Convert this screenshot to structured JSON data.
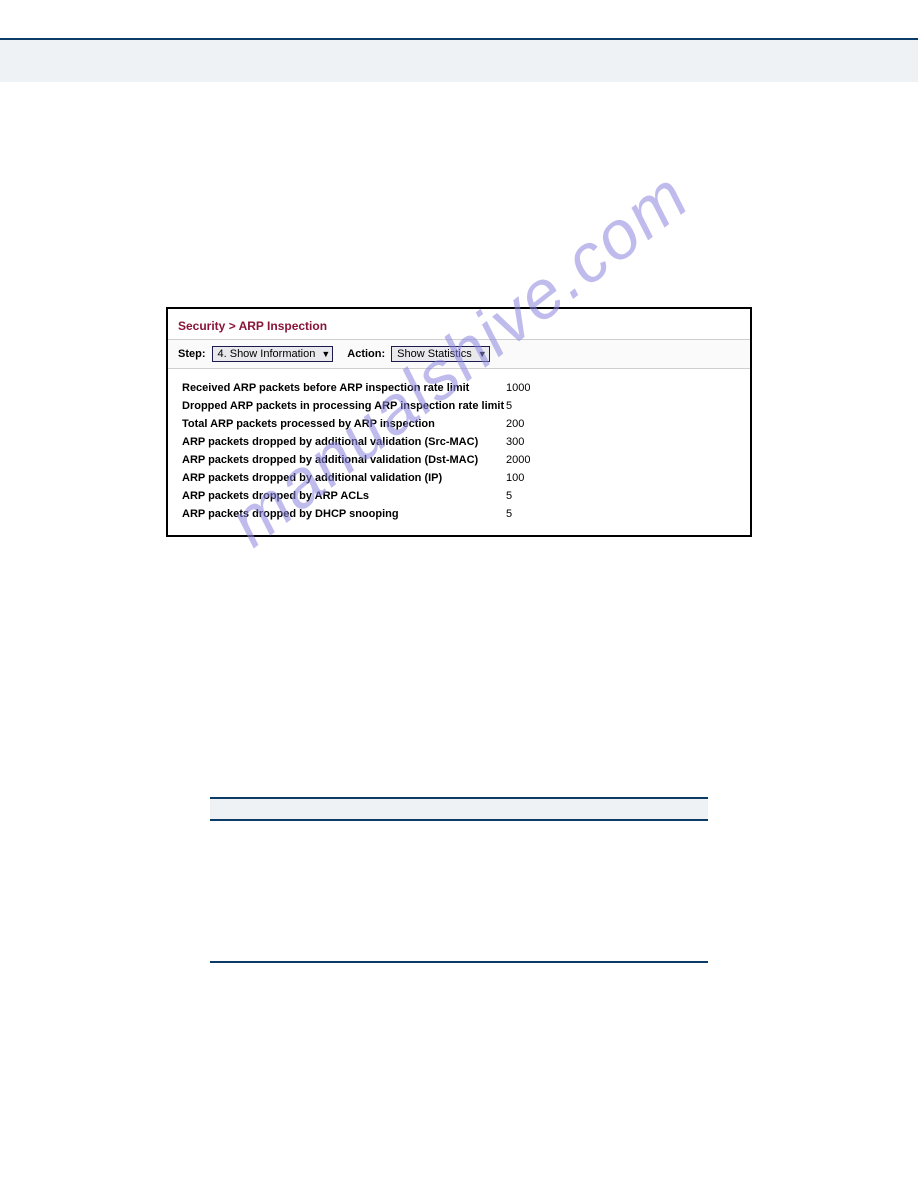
{
  "watermark": "manualshive.com",
  "screenshot": {
    "title": "Security > ARP Inspection",
    "stepLabel": "Step:",
    "stepValue": "4. Show Information",
    "actionLabel": "Action:",
    "actionValue": "Show Statistics",
    "rows": [
      {
        "label": "Received ARP packets before ARP inspection rate limit",
        "value": "1000"
      },
      {
        "label": "Dropped ARP packets in processing ARP inspection rate limit",
        "value": "5"
      },
      {
        "label": "Total ARP packets processed by ARP inspection",
        "value": "200"
      },
      {
        "label": "ARP packets dropped by additional validation (Src-MAC)",
        "value": "300"
      },
      {
        "label": "ARP packets dropped by additional validation (Dst-MAC)",
        "value": "2000"
      },
      {
        "label": "ARP packets dropped by additional validation (IP)",
        "value": "100"
      },
      {
        "label": "ARP packets dropped by ARP ACLs",
        "value": "5"
      },
      {
        "label": "ARP packets dropped by DHCP snooping",
        "value": "5"
      }
    ]
  }
}
